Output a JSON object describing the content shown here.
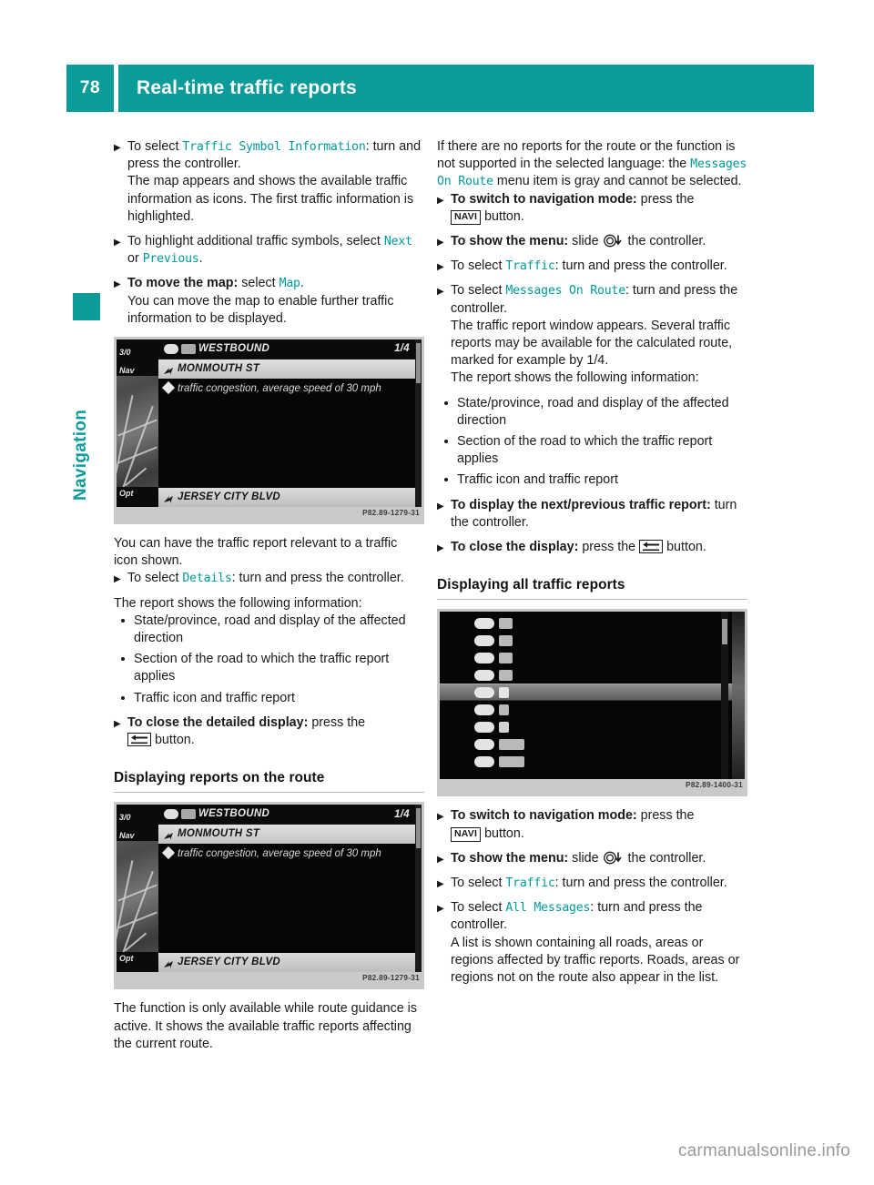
{
  "theme": {
    "accent": "#0c9b9b",
    "mono_accent": "#009a9a",
    "text": "#1a1a1a"
  },
  "header": {
    "page_number": "78",
    "title": "Real-time traffic reports"
  },
  "sidebar": {
    "chapter_label": "Navigation"
  },
  "left_column": {
    "step_traffic_symbol": {
      "lead": "To select ",
      "menu_item": "Traffic Symbol Information",
      "after": ": turn and press the controller.",
      "detail": "The map appears and shows the available traffic information as icons. The first traffic information is highlighted."
    },
    "step_highlight": {
      "lead": "To highlight additional traffic symbols, select ",
      "option_a": "Next",
      "conj": " or ",
      "option_b": "Previous",
      "after": "."
    },
    "step_move_map": {
      "bold": "To move the map:",
      "lead": " select ",
      "menu_item": "Map",
      "after": ".",
      "detail": "You can move the map to enable further traffic information to be displayed."
    },
    "figure1": {
      "caption_code": "P82.89-1279-31",
      "screen": {
        "map_labels": [
          "3/0",
          "Nav",
          "Opt"
        ],
        "header_road": "WESTBOUND",
        "page_indicator": "1/4",
        "selected_road": "MONMOUTH ST",
        "report_text": "traffic congestion, average speed of 30 mph",
        "footer_road": "JERSEY CITY BLVD"
      }
    },
    "para_relevant": "You can have the traffic report relevant to a traffic icon shown.",
    "step_details": {
      "lead": "To select ",
      "menu_item": "Details",
      "after": ": turn and press the controller."
    },
    "para_report_shows": "The report shows the following information:",
    "bullets": [
      "State/province, road and display of the affected direction",
      "Section of the road to which the traffic report applies",
      "Traffic icon and traffic report"
    ],
    "step_close_detailed": {
      "bold": "To close the detailed display:",
      "lead": " press the ",
      "key": "back-button",
      "after": " button."
    },
    "heading_route": "Displaying reports on the route",
    "figure2": {
      "caption_code": "P82.89-1279-31",
      "screen": {
        "map_labels": [
          "3/0",
          "Nav",
          "Opt"
        ],
        "header_road": "WESTBOUND",
        "page_indicator": "1/4",
        "selected_road": "MONMOUTH ST",
        "report_text": "traffic congestion, average speed of 30 mph",
        "footer_road": "JERSEY CITY BLVD"
      }
    },
    "para_function_available": "The function is only available while route guidance is active. It shows the available traffic reports affecting the current route."
  },
  "right_column": {
    "para_no_reports": {
      "part1": "If there are no reports for the route or the function is not supported in the selected language: the ",
      "menu_item": "Messages On Route",
      "part2": " menu item is gray and cannot be selected."
    },
    "step_nav_mode": {
      "bold": "To switch to navigation mode:",
      "lead": " press the ",
      "key_label": "NAVI",
      "after": " button."
    },
    "step_show_menu": {
      "bold": "To show the menu:",
      "lead": " slide ",
      "icon": "controller-slide-down-icon",
      "after": " the controller."
    },
    "step_traffic": {
      "lead": "To select ",
      "menu_item": "Traffic",
      "after": ": turn and press the controller."
    },
    "step_messages_on_route": {
      "lead": "To select ",
      "menu_item": "Messages On Route",
      "after": ": turn and press the controller.",
      "detail": "The traffic report window appears. Several traffic reports may be available for the calculated route, marked for example by 1/4.",
      "detail2": "The report shows the following information:"
    },
    "bullets": [
      "State/province, road and display of the affected direction",
      "Section of the road to which the traffic report applies",
      "Traffic icon and traffic report"
    ],
    "step_next_previous": {
      "bold": "To display the next/previous traffic report:",
      "after": " turn the controller."
    },
    "step_close_display": {
      "bold": "To close the display:",
      "lead": " press the ",
      "key": "back-button",
      "after": " button."
    },
    "heading_all": "Displaying all traffic reports",
    "figure3": {
      "caption_code": "P82.89-1400-31",
      "screen": {
        "rows": 9,
        "selected_row_index": 4
      }
    },
    "step_nav_mode_2": {
      "bold": "To switch to navigation mode:",
      "lead": " press the ",
      "key_label": "NAVI",
      "after": " button."
    },
    "step_show_menu_2": {
      "bold": "To show the menu:",
      "lead": " slide ",
      "icon": "controller-slide-down-icon",
      "after": " the controller."
    },
    "step_traffic_2": {
      "lead": "To select ",
      "menu_item": "Traffic",
      "after": ": turn and press the controller."
    },
    "step_all_messages": {
      "lead": "To select ",
      "menu_item": "All Messages",
      "after": ": turn and press the controller.",
      "detail": "A list is shown containing all roads, areas or regions affected by traffic reports. Roads, areas or regions not on the route also appear in the list."
    }
  },
  "footer": {
    "watermark": "carmanualsonline.info"
  }
}
